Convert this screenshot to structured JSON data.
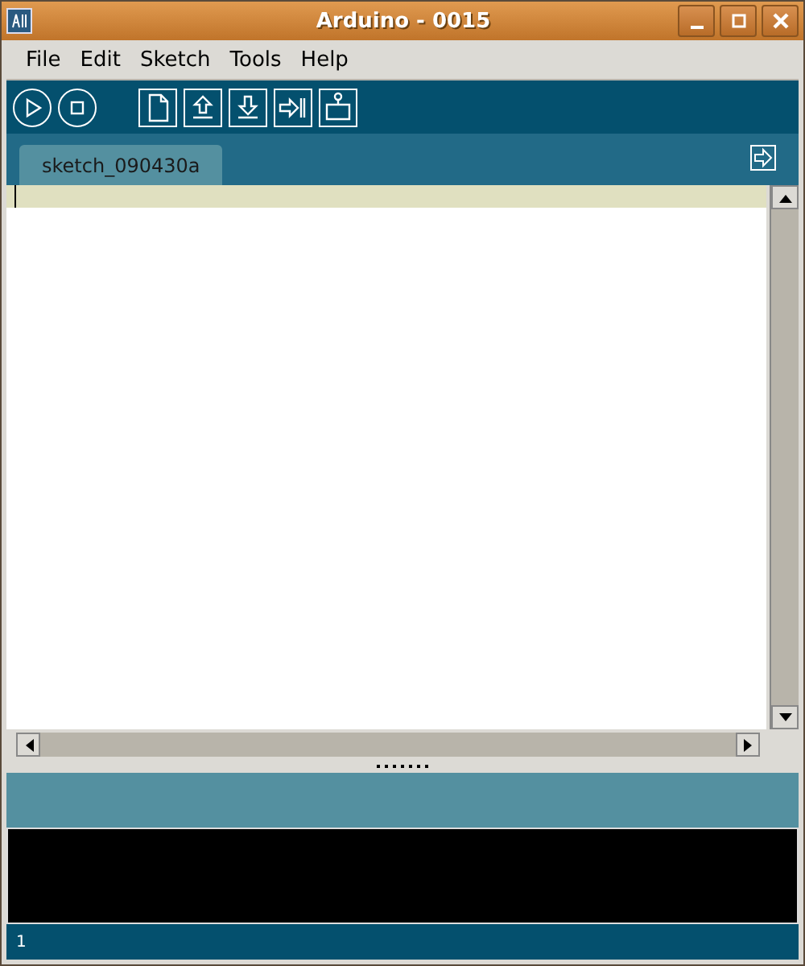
{
  "window": {
    "title": "Arduino - 0015"
  },
  "menu": [
    "File",
    "Edit",
    "Sketch",
    "Tools",
    "Help"
  ],
  "toolbar": [
    {
      "kind": "play"
    },
    {
      "kind": "stop"
    },
    {
      "kind": "new"
    },
    {
      "kind": "open"
    },
    {
      "kind": "save"
    },
    {
      "kind": "upload"
    },
    {
      "kind": "serial"
    }
  ],
  "tabs": [
    {
      "label": "sketch_090430a",
      "selected": true
    }
  ],
  "status_bar": {
    "line": "1"
  }
}
